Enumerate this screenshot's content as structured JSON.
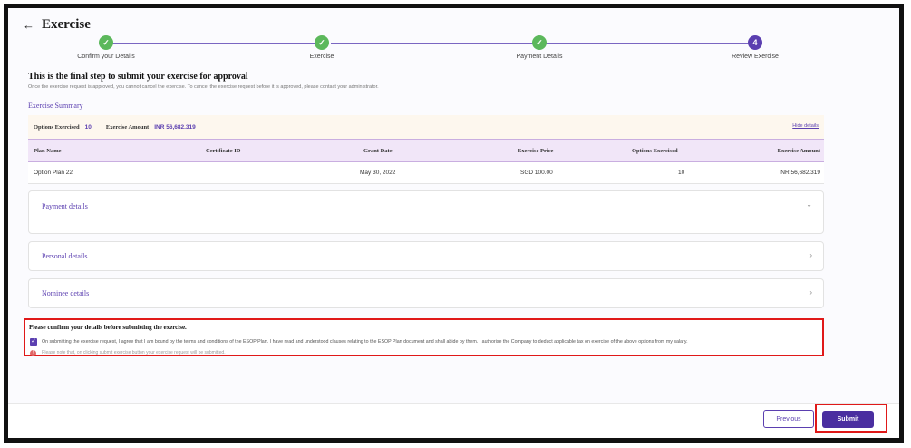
{
  "header": {
    "back_icon": "arrow-left-icon",
    "title": "Exercise"
  },
  "stepper": {
    "steps": [
      {
        "label": "Confirm your Details",
        "status": "done"
      },
      {
        "label": "Exercise",
        "status": "done"
      },
      {
        "label": "Payment Details",
        "status": "done"
      },
      {
        "label": "Review Exercise",
        "status": "active",
        "number": "4"
      }
    ]
  },
  "main": {
    "heading": "This is the final step to submit your exercise for approval",
    "subnote": "Once the exercise request is approved, you cannot cancel the exercise. To cancel the exercise request before it is approved, please contact your administrator.",
    "summary_title": "Exercise Summary"
  },
  "summary_bar": {
    "options_label": "Options Exercised",
    "options_value": "10",
    "amount_label": "Exercise Amount",
    "amount_value": "INR  56,682.319",
    "hide_link": "Hide details"
  },
  "table": {
    "headers": [
      "Plan Name",
      "Certificate ID",
      "Grant Date",
      "Exercise Price",
      "Options Exercised",
      "Exercise Amount"
    ],
    "rows": [
      [
        "Option Plan 22",
        "",
        "May 30, 2022",
        "SGD  100.00",
        "10",
        "INR  56,682.319"
      ]
    ]
  },
  "accordions": [
    {
      "title": "Payment details",
      "icon": "chevron-down-icon",
      "glyph": "⌄"
    },
    {
      "title": "Personal details",
      "icon": "chevron-right-icon",
      "glyph": "›"
    },
    {
      "title": "Nominee details",
      "icon": "chevron-right-icon",
      "glyph": "›"
    }
  ],
  "confirm": {
    "title": "Please confirm your details before submitting the exercise.",
    "agreement": "On submitting the exercise request, I agree that I am bound by the terms and conditions of the ESOP Plan. I have read and understood clauses relating to the ESOP Plan document and shall abide by them. I authorise the Company to deduct applicable tax on exercise of the above options from my salary.",
    "checked": true,
    "warning": "Please note that, on clicking submit exercise button your exercise request will be submitted."
  },
  "footer": {
    "previous_label": "Previous",
    "submit_label": "Submit"
  },
  "colors": {
    "accent": "#5b3fb0",
    "done": "#5cb85c",
    "highlight": "#e01919"
  }
}
